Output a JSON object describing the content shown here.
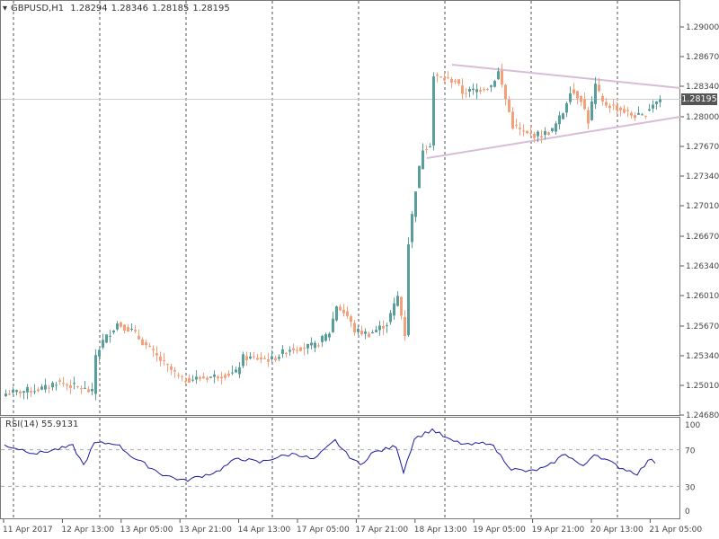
{
  "header": {
    "symbol": "GBPUSD,H1",
    "open": "1.28294",
    "high": "1.28346",
    "low": "1.28185",
    "close": "1.28195"
  },
  "rsi_label": {
    "name": "RSI(14)",
    "value": "55.9131"
  },
  "current_price": "1.28195",
  "colors": {
    "bull": "#5a9e9c",
    "bear": "#f4a07a",
    "trendline": "#d8bcd8",
    "rsi": "#1a1aa0",
    "grid": "#555555"
  },
  "chart_data": [
    {
      "type": "candlestick",
      "title": "GBPUSD,H1",
      "ylim": [
        1.2468,
        1.2933
      ],
      "yticks": [
        "1.29000",
        "1.28670",
        "1.28340",
        "1.28000",
        "1.27670",
        "1.27340",
        "1.27010",
        "1.26670",
        "1.26340",
        "1.26010",
        "1.25670",
        "1.25340",
        "1.25010",
        "1.24680"
      ],
      "xticks": [
        "11 Apr 2017",
        "12 Apr 13:00",
        "13 Apr 05:00",
        "13 Apr 21:00",
        "14 Apr 13:00",
        "17 Apr 05:00",
        "17 Apr 21:00",
        "18 Apr 13:00",
        "19 Apr 05:00",
        "19 Apr 21:00",
        "20 Apr 13:00",
        "21 Apr 05:00"
      ],
      "close_anchors_bar_price": [
        [
          0,
          1.2492
        ],
        [
          11,
          1.2498
        ],
        [
          14,
          1.2505
        ],
        [
          21,
          1.2498
        ],
        [
          24,
          1.2493
        ],
        [
          25,
          1.2535
        ],
        [
          27,
          1.255
        ],
        [
          31,
          1.257
        ],
        [
          35,
          1.2562
        ],
        [
          39,
          1.2545
        ],
        [
          44,
          1.2525
        ],
        [
          49,
          1.2507
        ],
        [
          56,
          1.251
        ],
        [
          64,
          1.2515
        ],
        [
          66,
          1.2532
        ],
        [
          74,
          1.253
        ],
        [
          79,
          1.2542
        ],
        [
          86,
          1.2545
        ],
        [
          90,
          1.256
        ],
        [
          92,
          1.259
        ],
        [
          95,
          1.2578
        ],
        [
          97,
          1.2562
        ],
        [
          101,
          1.2558
        ],
        [
          106,
          1.257
        ],
        [
          109,
          1.26
        ],
        [
          111,
          1.2558
        ],
        [
          112,
          1.266
        ],
        [
          114,
          1.272
        ],
        [
          116,
          1.2765
        ],
        [
          118,
          1.277
        ],
        [
          119,
          1.2845
        ],
        [
          122,
          1.2842
        ],
        [
          125,
          1.284
        ],
        [
          127,
          1.2827
        ],
        [
          131,
          1.283
        ],
        [
          135,
          1.2835
        ],
        [
          137,
          1.285
        ],
        [
          141,
          1.279
        ],
        [
          145,
          1.278
        ],
        [
          149,
          1.278
        ],
        [
          152,
          1.2785
        ],
        [
          155,
          1.2805
        ],
        [
          157,
          1.283
        ],
        [
          160,
          1.282
        ],
        [
          162,
          1.2795
        ],
        [
          164,
          1.2835
        ],
        [
          166,
          1.2815
        ],
        [
          170,
          1.281
        ],
        [
          174,
          1.2802
        ],
        [
          177,
          1.28
        ],
        [
          180,
          1.2815
        ],
        [
          182,
          1.28195
        ]
      ],
      "trendlines": [
        {
          "name": "upper",
          "from": [
            124.5,
            1.2858
          ],
          "to": [
            188,
            1.2832
          ]
        },
        {
          "name": "lower",
          "from": [
            117.5,
            1.2754
          ],
          "to": [
            188,
            1.28
          ]
        }
      ]
    },
    {
      "type": "line",
      "title": "RSI(14)",
      "ylim": [
        0,
        100
      ],
      "yticks": [
        "100",
        "70",
        "30",
        "0"
      ],
      "levels": [
        70,
        30
      ],
      "anchors_bar_value": [
        [
          0,
          75
        ],
        [
          9,
          66
        ],
        [
          19,
          74
        ],
        [
          22,
          53
        ],
        [
          25,
          77
        ],
        [
          31,
          77
        ],
        [
          36,
          61
        ],
        [
          44,
          43
        ],
        [
          50,
          36
        ],
        [
          59,
          46
        ],
        [
          65,
          61
        ],
        [
          71,
          56
        ],
        [
          75,
          61
        ],
        [
          81,
          66
        ],
        [
          86,
          59
        ],
        [
          92,
          80
        ],
        [
          95,
          66
        ],
        [
          99,
          53
        ],
        [
          102,
          66
        ],
        [
          109,
          74
        ],
        [
          111,
          46
        ],
        [
          114,
          82
        ],
        [
          119,
          92
        ],
        [
          124,
          80
        ],
        [
          129,
          75
        ],
        [
          135,
          78
        ],
        [
          141,
          49
        ],
        [
          146,
          46
        ],
        [
          151,
          51
        ],
        [
          156,
          66
        ],
        [
          161,
          51
        ],
        [
          164,
          66
        ],
        [
          171,
          51
        ],
        [
          176,
          44
        ],
        [
          180,
          61
        ],
        [
          181,
          56
        ]
      ]
    }
  ]
}
